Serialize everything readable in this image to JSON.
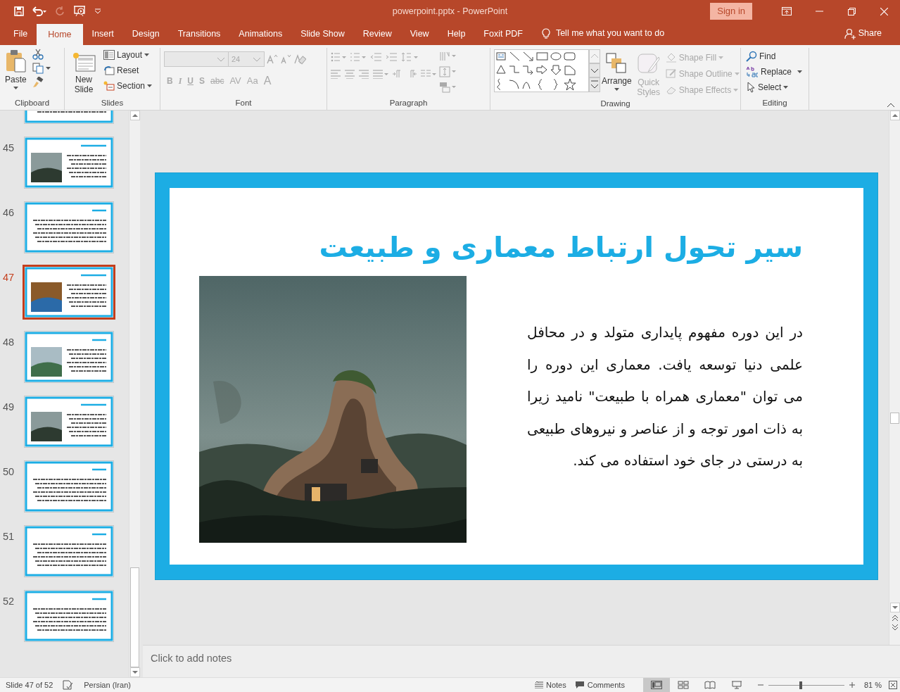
{
  "window": {
    "title": "powerpoint.pptx  -  PowerPoint",
    "sign_in": "Sign in"
  },
  "tabs": [
    {
      "label": "File",
      "selected": false
    },
    {
      "label": "Home",
      "selected": true
    },
    {
      "label": "Insert",
      "selected": false
    },
    {
      "label": "Design",
      "selected": false
    },
    {
      "label": "Transitions",
      "selected": false
    },
    {
      "label": "Animations",
      "selected": false
    },
    {
      "label": "Slide Show",
      "selected": false
    },
    {
      "label": "Review",
      "selected": false
    },
    {
      "label": "View",
      "selected": false
    },
    {
      "label": "Help",
      "selected": false
    },
    {
      "label": "Foxit PDF",
      "selected": false
    }
  ],
  "tell_me": "Tell me what you want to do",
  "share": "Share",
  "ribbon": {
    "clipboard": {
      "label": "Clipboard",
      "paste": "Paste"
    },
    "slides": {
      "label": "Slides",
      "new_slide": "New Slide",
      "layout": "Layout",
      "reset": "Reset",
      "section": "Section"
    },
    "font": {
      "label": "Font",
      "font_size": "24",
      "disabled": true,
      "format_buttons": [
        "B",
        "I",
        "U",
        "S",
        "abc",
        "AV",
        "Aa",
        "A"
      ]
    },
    "paragraph": {
      "label": "Paragraph",
      "disabled": true
    },
    "drawing": {
      "label": "Drawing",
      "arrange": "Arrange",
      "quick_styles": {
        "label": "Quick Styles",
        "disabled": true
      },
      "shape_items": [
        {
          "label": "Shape Fill",
          "disabled": true
        },
        {
          "label": "Shape Outline",
          "disabled": true
        },
        {
          "label": "Shape Effects",
          "disabled": true
        }
      ]
    },
    "editing": {
      "label": "Editing",
      "find": "Find",
      "replace": "Replace",
      "select": "Select"
    }
  },
  "thumbnails": [
    {
      "kind": "text",
      "selected": false
    },
    {
      "number": "45",
      "kind": "picture",
      "selected": false
    },
    {
      "number": "46",
      "kind": "text",
      "selected": false
    },
    {
      "number": "47",
      "kind": "picture",
      "selected": true
    },
    {
      "number": "48",
      "kind": "picture",
      "selected": false
    },
    {
      "number": "49",
      "kind": "picture",
      "selected": false
    },
    {
      "number": "50",
      "kind": "text",
      "selected": false
    },
    {
      "number": "51",
      "kind": "text",
      "selected": false
    },
    {
      "number": "52",
      "kind": "text",
      "selected": false
    }
  ],
  "slide": {
    "title": "سیر تحول ارتباط معماری و طبیعت",
    "body": "در این دوره مفهوم پایداری متولد و در محافل علمی دنیا توسعه یافت. معماری این دوره را می توان \"معماری همراه با طبیعت\" نامید زیرا به ذات امور توجه و از عناصر و نیروهای طبیعی به درستی در جای خود استفاده می کند."
  },
  "notes": {
    "placeholder": "Click to add notes"
  },
  "status_bar": {
    "slide_info": "Slide 47 of 52",
    "language": "Persian (Iran)",
    "notes": "Notes",
    "comments": "Comments",
    "views": [
      {
        "kind": "normal",
        "selected": true
      },
      {
        "kind": "sorter",
        "selected": false
      },
      {
        "kind": "reading",
        "selected": false
      },
      {
        "kind": "slideshow",
        "selected": false
      }
    ],
    "zoom": {
      "level": 0.43,
      "reading": "81 %"
    }
  }
}
